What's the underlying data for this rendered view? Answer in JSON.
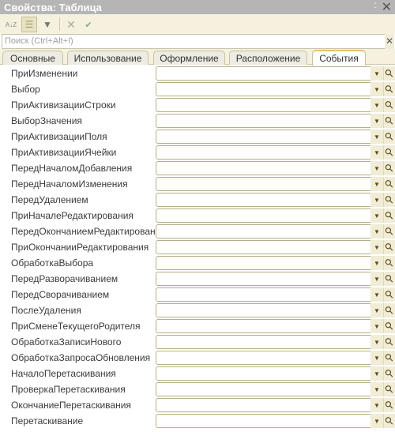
{
  "window": {
    "title": "Свойства: Таблица",
    "pin": "⍘",
    "close": "✕"
  },
  "toolbar": {
    "sort": "A↓Z",
    "tree": "☰",
    "filter": "▼",
    "cancel": "✕",
    "ok": "✔"
  },
  "search": {
    "placeholder": "Поиск (Ctrl+Alt+I)",
    "clear": "✕"
  },
  "tabs": [
    "Основные",
    "Использование",
    "Оформление",
    "Расположение",
    "События"
  ],
  "active_tab": "События",
  "events": [
    "ПриИзменении",
    "Выбор",
    "ПриАктивизацииСтроки",
    "ВыборЗначения",
    "ПриАктивизацииПоля",
    "ПриАктивизацииЯчейки",
    "ПередНачаломДобавления",
    "ПередНачаломИзменения",
    "ПередУдалением",
    "ПриНачалеРедактирования",
    "ПередОкончаниемРедактирования",
    "ПриОкончанииРедактирования",
    "ОбработкаВыбора",
    "ПередРазворачиванием",
    "ПередСворачиванием",
    "ПослеУдаления",
    "ПриСменеТекущегоРодителя",
    "ОбработкаЗаписиНового",
    "ОбработкаЗапросаОбновления",
    "НачалоПеретаскивания",
    "ПроверкаПеретаскивания",
    "ОкончаниеПеретаскивания",
    "Перетаскивание"
  ]
}
